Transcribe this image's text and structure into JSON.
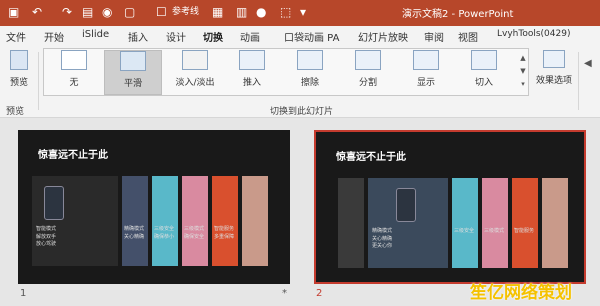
{
  "titlebar": {
    "doc_title": "演示文稿2 - PowerPoint",
    "reference_line": "参考线"
  },
  "tabs": [
    "文件",
    "开始",
    "iSlide",
    "插入",
    "设计",
    "切换",
    "动画",
    "口袋动画 PA",
    "幻灯片放映",
    "审阅",
    "视图",
    "LvyhTools(0429)"
  ],
  "active_tab": "切换",
  "ribbon": {
    "preview_label": "预览",
    "preview_group": "预览",
    "transitions": [
      "无",
      "平滑",
      "淡入/淡出",
      "推入",
      "擦除",
      "分割",
      "显示",
      "切入"
    ],
    "selected_transition": "平滑",
    "effect_options": "效果选项",
    "gallery_group": "切换到此幻灯片"
  },
  "slides": [
    {
      "number": "1",
      "title": "惊喜远不止于此",
      "star": "*"
    },
    {
      "number": "2",
      "title": "惊喜远不止于此",
      "star": ""
    }
  ],
  "slide_cards": [
    {
      "label": "智能模式",
      "sub1": "解放双手",
      "sub2": "放心驾驶"
    },
    {
      "label": "精确模式",
      "sub1": "关心精确",
      "sub2": "更关心你"
    },
    {
      "label": "三级安全",
      "sub1": "确保恭小",
      "sub2": "安全性"
    },
    {
      "label": "三级模式",
      "sub1": "确保安全",
      "sub2": "五星安全"
    },
    {
      "label": "智能服务",
      "sub1": "多重保障",
      "sub2": "更加放心"
    }
  ],
  "watermark": "笙亿网络策划",
  "colors": {
    "accent": "#b7472a",
    "selection": "#c43b2e"
  }
}
